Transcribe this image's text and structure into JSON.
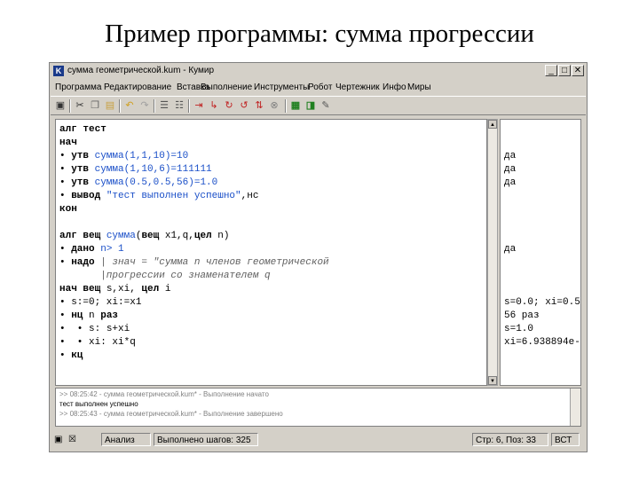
{
  "slide": {
    "title": "Пример программы: сумма прогрессии"
  },
  "window": {
    "title": "сумма геометрической.kum - Кумир",
    "app_icon": "K",
    "controls": {
      "minimize": "_",
      "maximize": "□",
      "close": "✕"
    }
  },
  "menu": {
    "items": [
      "Программа",
      "Редактирование",
      "Вставка",
      "Выполнение",
      "Инструменты",
      "Робот",
      "Чертежник",
      "Инфо",
      "Миры"
    ]
  },
  "toolbar": {
    "icons": [
      "save-icon",
      "cut-icon",
      "copy-icon",
      "paste-icon",
      "undo-icon",
      "redo-icon",
      "indent-icon",
      "outdent-icon",
      "run-icon",
      "step-icon",
      "step-in-icon",
      "step-out-icon",
      "stop-icon",
      "robot-icon",
      "drawer-icon",
      "edit-icon"
    ]
  },
  "editor": {
    "lines": [
      [
        {
          "t": "алг ",
          "c": "kw"
        },
        {
          "t": "тест",
          "c": "kw"
        }
      ],
      [
        {
          "t": "нач",
          "c": "kw"
        }
      ],
      [
        {
          "t": "• ",
          "c": ""
        },
        {
          "t": "утв ",
          "c": "kw"
        },
        {
          "t": "сумма",
          "c": "fn"
        },
        {
          "t": "(1,1,10)=10",
          "c": "num"
        }
      ],
      [
        {
          "t": "• ",
          "c": ""
        },
        {
          "t": "утв ",
          "c": "kw"
        },
        {
          "t": "сумма",
          "c": "fn"
        },
        {
          "t": "(1,10,6)=111111",
          "c": "num"
        }
      ],
      [
        {
          "t": "• ",
          "c": ""
        },
        {
          "t": "утв ",
          "c": "kw"
        },
        {
          "t": "сумма",
          "c": "fn"
        },
        {
          "t": "(0.5,0.5,56)=1.0",
          "c": "num"
        }
      ],
      [
        {
          "t": "• ",
          "c": ""
        },
        {
          "t": "вывод ",
          "c": "kw"
        },
        {
          "t": "\"тест выполнен успешно\"",
          "c": "str"
        },
        {
          "t": ",нс",
          "c": ""
        }
      ],
      [
        {
          "t": "кон",
          "c": "kw"
        }
      ],
      [
        {
          "t": "",
          "c": ""
        }
      ],
      [
        {
          "t": "алг ",
          "c": "kw"
        },
        {
          "t": "вещ ",
          "c": "kw"
        },
        {
          "t": "сумма",
          "c": "fn"
        },
        {
          "t": "(",
          "c": ""
        },
        {
          "t": "вещ ",
          "c": "kw"
        },
        {
          "t": "x1,q,",
          "c": ""
        },
        {
          "t": "цел ",
          "c": "kw"
        },
        {
          "t": "n)",
          "c": ""
        }
      ],
      [
        {
          "t": "• ",
          "c": ""
        },
        {
          "t": "дано ",
          "c": "kw"
        },
        {
          "t": "n> 1",
          "c": "num"
        }
      ],
      [
        {
          "t": "• ",
          "c": ""
        },
        {
          "t": "надо ",
          "c": "kw"
        },
        {
          "t": "| знач = \"сумма n членов геометрической",
          "c": "cm"
        }
      ],
      [
        {
          "t": "       |прогрессии со знаменателем q",
          "c": "cm"
        }
      ],
      [
        {
          "t": "нач ",
          "c": "kw"
        },
        {
          "t": "вещ ",
          "c": "kw"
        },
        {
          "t": "s,xi, ",
          "c": ""
        },
        {
          "t": "цел ",
          "c": "kw"
        },
        {
          "t": "i",
          "c": ""
        }
      ],
      [
        {
          "t": "• ",
          "c": ""
        },
        {
          "t": "s:=0; xi:=x1",
          "c": ""
        }
      ],
      [
        {
          "t": "• ",
          "c": ""
        },
        {
          "t": "нц ",
          "c": "kw"
        },
        {
          "t": "n ",
          "c": ""
        },
        {
          "t": "раз",
          "c": "kw"
        }
      ],
      [
        {
          "t": "•  • ",
          "c": ""
        },
        {
          "t": "s: s+xi",
          "c": ""
        }
      ],
      [
        {
          "t": "•  • ",
          "c": ""
        },
        {
          "t": "xi: xi*q",
          "c": ""
        }
      ],
      [
        {
          "t": "• ",
          "c": ""
        },
        {
          "t": "кц",
          "c": "kw"
        }
      ]
    ]
  },
  "margin": {
    "lines": [
      "",
      "",
      "да",
      "да",
      "да",
      "",
      "",
      "",
      "",
      "да",
      "",
      "",
      "",
      "s=0.0; xi=0.5",
      "56 раз",
      "s=1.0",
      "xi=6.938894e-",
      ""
    ]
  },
  "console": {
    "lines": [
      ">> 08:25:42 - сумма геометрической.kum* - Выполнение начато",
      "тест выполнен успешно",
      ">> 08:25:43 - сумма геометрической.kum* - Выполнение завершено"
    ]
  },
  "status": {
    "mode": "Анализ",
    "steps": "Выполнено шагов: 325",
    "position": "Стр: 6, Поз: 33",
    "insert": "ВСТ"
  }
}
